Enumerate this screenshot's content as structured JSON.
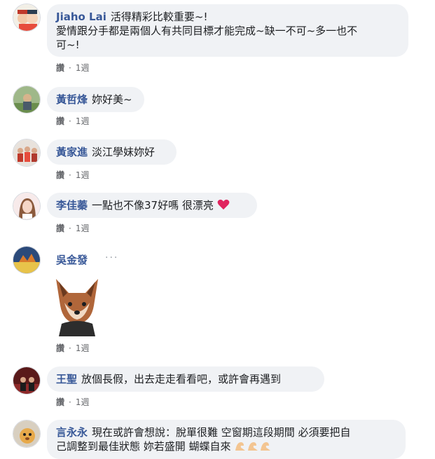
{
  "comments": [
    {
      "name": "Jiaho Lai",
      "line1": "活得精彩比較重要~!",
      "line2": "愛情跟分手都是兩個人有共同目標才能完成~缺一不可~多一也不",
      "line3": "可~!",
      "like": "讚",
      "time": "1週"
    },
    {
      "name": "黃哲烽",
      "text": "妳好美~",
      "like": "讚",
      "time": "1週"
    },
    {
      "name": "黃家進",
      "text": "淡江學妹妳好",
      "like": "讚",
      "time": "1週"
    },
    {
      "name": "李佳蓁",
      "text": "一點也不像37好嗎 很漂亮",
      "like": "讚",
      "time": "1週"
    },
    {
      "name": "吳金發",
      "more": "···",
      "like": "讚",
      "time": "1週"
    },
    {
      "name": "王聖",
      "text": "放個長假，出去走走看看吧，或許會再遇到",
      "like": "讚",
      "time": "1週"
    },
    {
      "name": "言永永",
      "line1": "現在或許會想說：脫單很難 空窗期這段期間 必須要把自",
      "line2": "己調整到最佳狀態 妳若盛開 蝴蝶自來"
    }
  ],
  "colors": {
    "name": "#385898",
    "bubble": "#f0f2f5",
    "meta": "#65676b",
    "heart": "#e0245e"
  }
}
